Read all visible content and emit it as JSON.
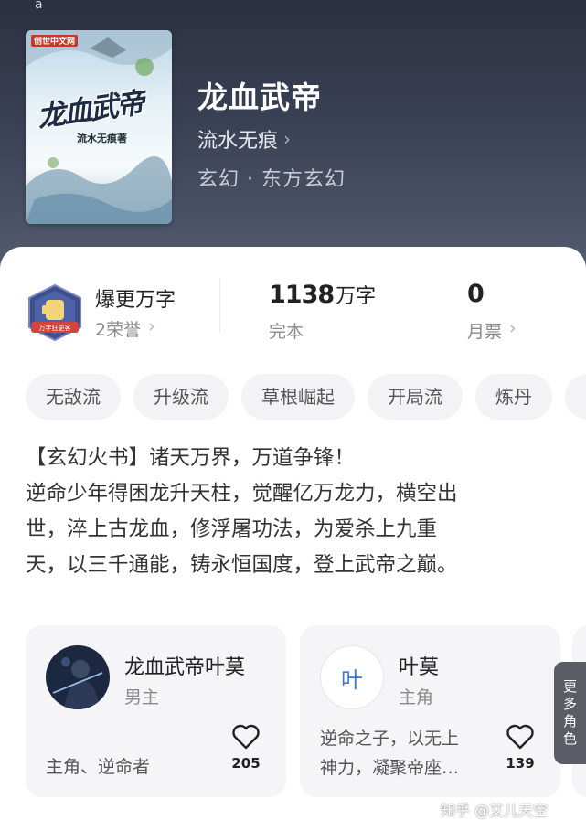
{
  "book": {
    "corner_mark": "a",
    "cover_publisher": "创世中文网",
    "cover_title": "龙血武帝",
    "cover_author": "流水无痕著",
    "title": "龙血武帝",
    "author": "流水无痕",
    "genre": "玄幻 · 东方玄幻"
  },
  "stats": {
    "honor_title": "爆更万字",
    "honor_sub": "2荣誉",
    "badge_text": "万字狂更客",
    "words_num": "1138",
    "words_unit": "万字",
    "words_status": "完本",
    "ticket_num": "0",
    "ticket_label": "月票",
    "chevron": "›"
  },
  "tags": [
    "无敌流",
    "升级流",
    "草根崛起",
    "开局流",
    "炼丹"
  ],
  "intro": [
    "【玄幻火书】诸天万界，万道争锋！",
    "逆命少年得困龙升天柱，觉醒亿万龙力，横空出",
    "世，淬上古龙血，修浮屠功法，为爱杀上九重",
    "天，以三千通能，铸永恒国度，登上武帝之巅。"
  ],
  "roles": [
    {
      "name": "龙血武帝叶莫",
      "type": "男主",
      "desc": "主角、逆命者",
      "likes": "205"
    },
    {
      "name": "叶莫",
      "type": "主角",
      "avatar_char": "叶",
      "desc_line1": "逆命之子，以无上",
      "desc_line2": "神力，凝聚帝座…",
      "likes": "139"
    }
  ],
  "more_roles": [
    "更",
    "多",
    "角",
    "色"
  ],
  "watermark": "知乎 @艾儿天空",
  "colors": {
    "header_top": "#2b3041",
    "header_bottom": "#565c70",
    "card_bg": "#f5f5f7",
    "accent_blue": "#3a7bd5"
  }
}
